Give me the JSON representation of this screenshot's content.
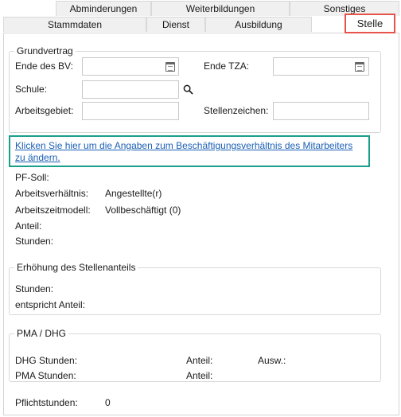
{
  "tabs": {
    "row1": [
      "Abminderungen",
      "Weiterbildungen",
      "Sonstiges"
    ],
    "row2": [
      "Stammdaten",
      "Dienst",
      "Ausbildung"
    ],
    "active": "Stelle"
  },
  "grundvertrag": {
    "title": "Grundvertrag",
    "ende_bv_label": "Ende des BV:",
    "ende_tza_label": "Ende TZA:",
    "schule_label": "Schule:",
    "arbeitsgebiet_label": "Arbeitsgebiet:",
    "stellenzeichen_label": "Stellenzeichen:",
    "ende_bv_value": "",
    "ende_tza_value": "",
    "schule_value": "",
    "arbeitsgebiet_value": "",
    "stellenzeichen_value": ""
  },
  "link": {
    "text": "Klicken Sie hier um die Angaben zum Beschäftigungsverhältnis des Mitarbeiters zu ändern."
  },
  "info": {
    "pf_soll_label": "PF-Soll:",
    "arbeitsverhaeltnis_label": "Arbeitsverhältnis:",
    "arbeitsverhaeltnis_value": "Angestellte(r)",
    "arbeitszeitmodell_label": "Arbeitszeitmodell:",
    "arbeitszeitmodell_value": "Vollbeschäftigt (0)",
    "anteil_label": "Anteil:",
    "stunden_label": "Stunden:"
  },
  "erhoehung": {
    "title": "Erhöhung des Stellenanteils",
    "stunden_label": "Stunden:",
    "anteil_label": "entspricht Anteil:"
  },
  "pma": {
    "title": "PMA / DHG",
    "dhg_stunden_label": "DHG Stunden:",
    "pma_stunden_label": "PMA Stunden:",
    "anteil1_label": "Anteil:",
    "anteil2_label": "Anteil:",
    "ausw_label": "Ausw.:"
  },
  "pflicht": {
    "label": "Pflichtstunden:",
    "value": "0"
  },
  "colors": {
    "active_tab_border": "#e5534b",
    "link_box_border": "#1a9f8c",
    "link_text": "#1a5fb4"
  },
  "icons": {
    "calendar": "calendar-icon",
    "search": "search-icon"
  }
}
